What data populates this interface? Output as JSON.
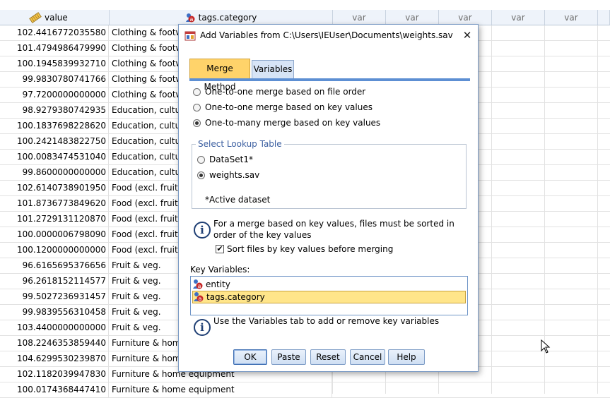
{
  "columns": {
    "value": "value",
    "category": "tags.category",
    "var_labels": [
      "var",
      "var",
      "var",
      "var",
      "var"
    ]
  },
  "rows": [
    {
      "value": "102.4416772035580",
      "category": "Clothing & footw"
    },
    {
      "value": "101.4794986479990",
      "category": "Clothing & footw"
    },
    {
      "value": "100.1945839932710",
      "category": "Clothing & footw"
    },
    {
      "value": "99.9830780741766",
      "category": "Clothing & footw"
    },
    {
      "value": "97.7200000000000",
      "category": "Clothing & footw"
    },
    {
      "value": "98.9279380742935",
      "category": "Education, cultu"
    },
    {
      "value": "100.1837698228620",
      "category": "Education, cultu"
    },
    {
      "value": "100.2421483822750",
      "category": "Education, cultu"
    },
    {
      "value": "100.0083474531040",
      "category": "Education, cultu"
    },
    {
      "value": "99.8600000000000",
      "category": "Education, cultu"
    },
    {
      "value": "102.6140738901950",
      "category": "Food (excl. fruit"
    },
    {
      "value": "101.8736773849620",
      "category": "Food (excl. fruit"
    },
    {
      "value": "101.2729131120870",
      "category": "Food (excl. fruit"
    },
    {
      "value": "100.0000006798090",
      "category": "Food (excl. fruit"
    },
    {
      "value": "100.1200000000000",
      "category": "Food (excl. fruit"
    },
    {
      "value": "96.6165695376656",
      "category": "Fruit & veg."
    },
    {
      "value": "96.2618152114577",
      "category": "Fruit & veg."
    },
    {
      "value": "99.5027236931457",
      "category": "Fruit & veg."
    },
    {
      "value": "99.9839556310458",
      "category": "Fruit & veg."
    },
    {
      "value": "103.4400000000000",
      "category": "Fruit & veg."
    },
    {
      "value": "108.2246353859440",
      "category": "Furniture & home"
    },
    {
      "value": "104.6299530239870",
      "category": "Furniture & home"
    },
    {
      "value": "102.1182039947830",
      "category": "Furniture & home equipment"
    },
    {
      "value": "100.0174368447410",
      "category": "Furniture & home equipment"
    }
  ],
  "dialog": {
    "title": "Add Variables from C:\\Users\\IEUser\\Documents\\weights.sav",
    "close_glyph": "✕",
    "tabs": {
      "merge_method": "Merge Method",
      "variables": "Variables"
    },
    "merge_options": {
      "file_order": "One-to-one merge based on file order",
      "key_values": "One-to-one merge based on key values",
      "one_to_many": "One-to-many merge based on key values",
      "selected": "one_to_many"
    },
    "lookup": {
      "legend": "Select Lookup Table",
      "dataset1": "DataSet1*",
      "weights": "weights.sav",
      "active_note": "*Active dataset",
      "selected": "weights"
    },
    "info_glyph": "i",
    "sort_info": "For a merge based on key values, files must be sorted in order of the key values",
    "sort_checkbox": "Sort files by key values before merging",
    "sort_checked": true,
    "check_glyph": "✔",
    "key_variables_label": "Key Variables:",
    "key_variables": [
      "entity",
      "tags.category"
    ],
    "key_variables_selected": "tags.category",
    "variables_tab_info": "Use the Variables tab to add or remove key variables",
    "buttons": {
      "ok": "OK",
      "paste": "Paste",
      "reset": "Reset",
      "cancel": "Cancel",
      "help": "Help"
    }
  },
  "colors": {
    "accent_tab": "#ffd36a",
    "selection": "#ffe58a",
    "header_bg": "#eef3fa",
    "group_legend": "#3a5ea0"
  },
  "icons": [
    "ruler-scale-icon",
    "nominal-variable-icon",
    "app-icon",
    "close-icon",
    "info-icon",
    "checkbox-icon",
    "mouse-cursor-icon"
  ]
}
